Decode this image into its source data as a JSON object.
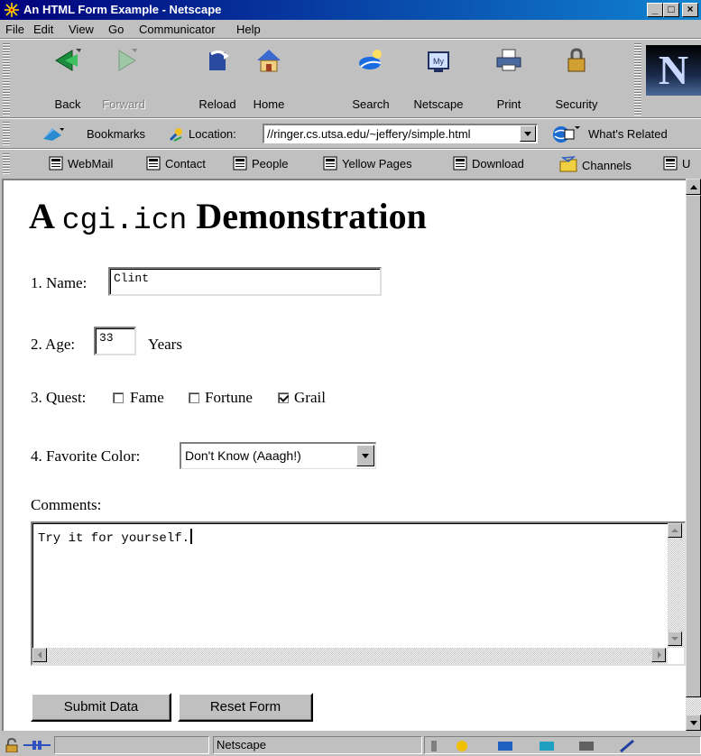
{
  "window": {
    "title": "An HTML Form Example - Netscape",
    "controls": [
      "_",
      "□",
      "×"
    ]
  },
  "menu": [
    "File",
    "Edit",
    "View",
    "Go",
    "Communicator",
    "Help"
  ],
  "nav": {
    "back": "Back",
    "forward": "Forward",
    "reload": "Reload",
    "home": "Home",
    "search": "Search",
    "netscape": "Netscape",
    "print": "Print",
    "security": "Security"
  },
  "location_bar": {
    "bookmarks": "Bookmarks",
    "location_label": "Location:",
    "url": "//ringer.cs.utsa.edu/~jeffery/simple.html",
    "whats_related": "What's Related"
  },
  "personal_toolbar": [
    "WebMail",
    "Contact",
    "People",
    "Yellow Pages",
    "Download",
    "Channels",
    "U"
  ],
  "page": {
    "heading_prefix": "A",
    "heading_code": "cgi.icn",
    "heading_suffix": "Demonstration",
    "name_label": "1. Name:",
    "name_value": "Clint",
    "age_label": "2. Age:",
    "age_value": "33",
    "age_unit": "Years",
    "quest_label": "3. Quest:",
    "quest_options": [
      {
        "label": "Fame",
        "checked": false
      },
      {
        "label": "Fortune",
        "checked": false
      },
      {
        "label": "Grail",
        "checked": true
      }
    ],
    "color_label": "4. Favorite Color:",
    "color_value": "Don't Know (Aaagh!)",
    "comments_label": "Comments:",
    "comments_value": "Try it for yourself.",
    "submit_label": "Submit Data",
    "reset_label": "Reset Form"
  },
  "status": {
    "text": "Netscape"
  }
}
